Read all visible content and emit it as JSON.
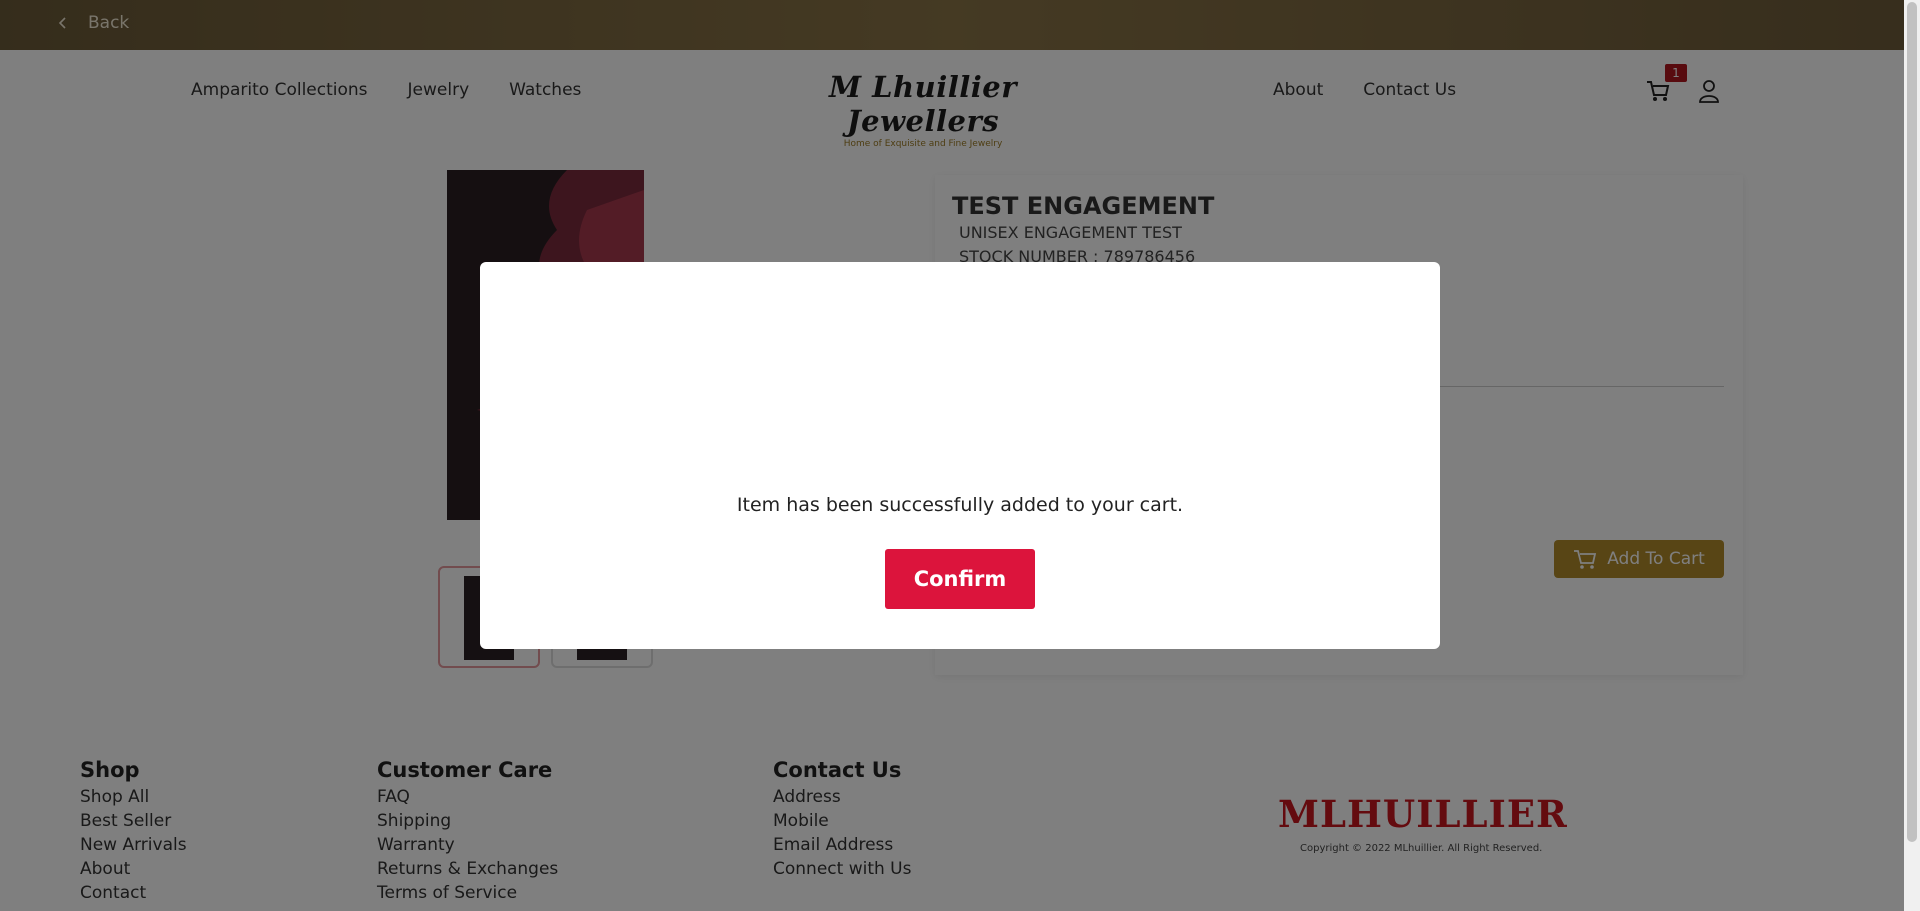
{
  "topbar": {
    "back_label": "Back"
  },
  "nav": {
    "left": [
      "Amparito Collections",
      "Jewelry",
      "Watches"
    ],
    "right": [
      "About",
      "Contact Us"
    ],
    "logo_text": "M Lhuillier Jewellers",
    "logo_tagline": "Home of Exquisite and Fine Jewelry",
    "cart_count": "1"
  },
  "product": {
    "title": "TEST ENGAGEMENT",
    "subtitle": "UNISEX ENGAGEMENT TEST",
    "stock": "STOCK NUMBER : 789786456",
    "add_to_cart_label": "Add To Cart"
  },
  "footer": {
    "shop": {
      "heading": "Shop",
      "items": [
        "Shop All",
        "Best Seller",
        "New Arrivals",
        "About",
        "Contact"
      ]
    },
    "care": {
      "heading": "Customer Care",
      "items": [
        "FAQ",
        "Shipping",
        "Warranty",
        "Returns & Exchanges",
        "Terms of Service"
      ]
    },
    "contact": {
      "heading": "Contact Us",
      "items": [
        "Address",
        "Mobile",
        "Email Address",
        "Connect with Us"
      ]
    },
    "brand": "MLHUILLIER",
    "copyright": "Copyright © 2022 MLhuillier. All Right Reserved."
  },
  "modal": {
    "message": "Item has been successfully added to your cart.",
    "confirm_label": "Confirm"
  },
  "colors": {
    "accent": "#dc143c",
    "gold": "#b08a2a",
    "brand_red": "#c8161e"
  }
}
